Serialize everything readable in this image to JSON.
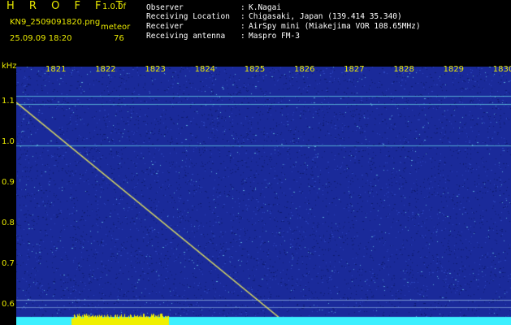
{
  "header": {
    "app_title": "H R O F F T",
    "version": "1.0.0f",
    "filename": "KN9_2509091820.png",
    "trace_type": "meteor",
    "timestamp": "25.09.09 18:20",
    "trace_value": "76",
    "meta": [
      {
        "label": "Observer",
        "value": "K.Nagai"
      },
      {
        "label": "Receiving Location",
        "value": "Chigasaki, Japan (139.414 35.340)"
      },
      {
        "label": "Receiver",
        "value": "AirSpy mini (Miakejima VOR 108.65MHz)"
      },
      {
        "label": "Receiving antenna",
        "value": "Maspro FM-3"
      }
    ],
    "colon": ":"
  },
  "axis": {
    "y_unit": "kHz",
    "y_ticks": [
      "1.1",
      "1.0",
      "0.9",
      "0.8",
      "0.7",
      "0.6"
    ],
    "x_ticks": [
      "1821",
      "1822",
      "1823",
      "1824",
      "1825",
      "1826",
      "1827",
      "1828",
      "1829",
      "1830"
    ]
  },
  "colors": {
    "background": "#000000",
    "spectrogram_base": "#1a2a9a",
    "noise_light": "#5aa8d8",
    "trace": "#e0e060",
    "carrier": "#60c8e0",
    "label": "#e8e800",
    "bottom_band": "#3cf0ff"
  }
}
